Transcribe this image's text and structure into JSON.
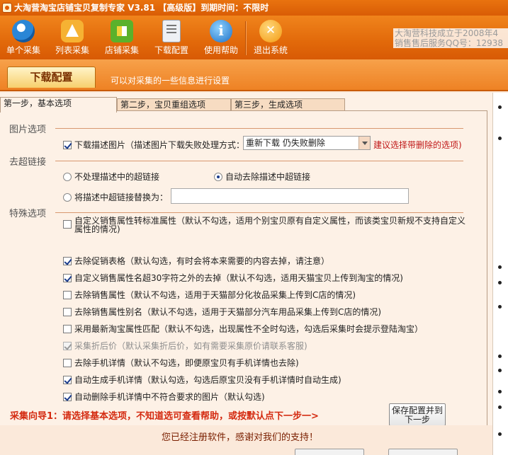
{
  "window": {
    "title": "大淘营淘宝店铺宝贝复制专家 V3.81 【高级版】到期时间：不限时"
  },
  "toolbar": {
    "buttons": [
      {
        "label": "单个采集",
        "icon": "single-collect-icon"
      },
      {
        "label": "列表采集",
        "icon": "list-collect-icon"
      },
      {
        "label": "店铺采集",
        "icon": "shop-collect-icon"
      },
      {
        "label": "下载配置",
        "icon": "download-config-icon"
      },
      {
        "label": "使用帮助",
        "icon": "help-icon"
      },
      {
        "label": "退出系统",
        "icon": "exit-icon"
      }
    ],
    "company_line1": "大淘营科技成立于2008年4",
    "company_line2": "销售售后服务QQ号：12938"
  },
  "section": {
    "title": "下载配置",
    "hint": "可以对采集的一些信息进行设置"
  },
  "tabs": [
    {
      "label": "第一步，基本选项",
      "active": true
    },
    {
      "label": "第二步，宝贝重组选项",
      "active": false
    },
    {
      "label": "第三步，生成选项",
      "active": false
    }
  ],
  "image_options": {
    "group_label": "图片选项",
    "download_desc_images": {
      "label": "下载描述图片（描述图片下载失败处理方式：",
      "checked": true
    },
    "failure_mode_select": {
      "value": "重新下载 仍失败删除"
    },
    "suggestion_text": "建议选择带删除的选项)"
  },
  "hyperlink_options": {
    "group_label": "去超链接",
    "radio_keep": {
      "label": "不处理描述中的超链接",
      "selected": false
    },
    "radio_auto_remove": {
      "label": "自动去除描述中超链接",
      "selected": true
    },
    "radio_replace": {
      "label": "将描述中超链接替换为：",
      "selected": false
    },
    "replace_input": {
      "value": ""
    }
  },
  "special_options": {
    "group_label": "特殊选项",
    "items": [
      {
        "label": "自定义销售属性转标准属性（默认不勾选，适用个别宝贝原有自定义属性，而该类宝贝新规不支持自定义属性的情况)",
        "checked": false,
        "disabled": false
      },
      {
        "label": "去除促销表格（默认勾选，有时会将本来需要的内容去掉，请注意）",
        "checked": true,
        "disabled": false
      },
      {
        "label": "自定义销售属性名超30字符之外的去掉（默认不勾选，适用天猫宝贝上传到淘宝的情况)",
        "checked": true,
        "disabled": false
      },
      {
        "label": "去除销售属性（默认不勾选，适用于天猫部分化妆品采集上传到C店的情况)",
        "checked": false,
        "disabled": false
      },
      {
        "label": "去除销售属性别名（默认不勾选，适用于天猫部分汽车用品采集上传到C店的情况)",
        "checked": false,
        "disabled": false
      },
      {
        "label": "采用最新淘宝属性匹配（默认不勾选，出现属性不全时勾选，勾选后采集时会提示登陆淘宝）",
        "checked": false,
        "disabled": false
      },
      {
        "label": "采集折后价（默认采集折后价，如有需要采集原价请联系客服)",
        "checked": true,
        "disabled": true
      },
      {
        "label": "去除手机详情（默认不勾选，即便原宝贝有手机详情也去除)",
        "checked": false,
        "disabled": false
      },
      {
        "label": "自动生成手机详情（默认勾选，勾选后原宝贝没有手机详情时自动生成)",
        "checked": true,
        "disabled": false
      },
      {
        "label": "自动删除手机详情中不符合要求的图片（默认勾选)",
        "checked": true,
        "disabled": false
      }
    ]
  },
  "guide_text": "采集向导1：请选择基本选项，不知道选可查看帮助，或按默认点下一步一>",
  "save_button": {
    "line1": "保存配置并到",
    "line2": "下一步"
  },
  "footer": {
    "message": "您已经注册软件，感谢对我们的支持！"
  }
}
